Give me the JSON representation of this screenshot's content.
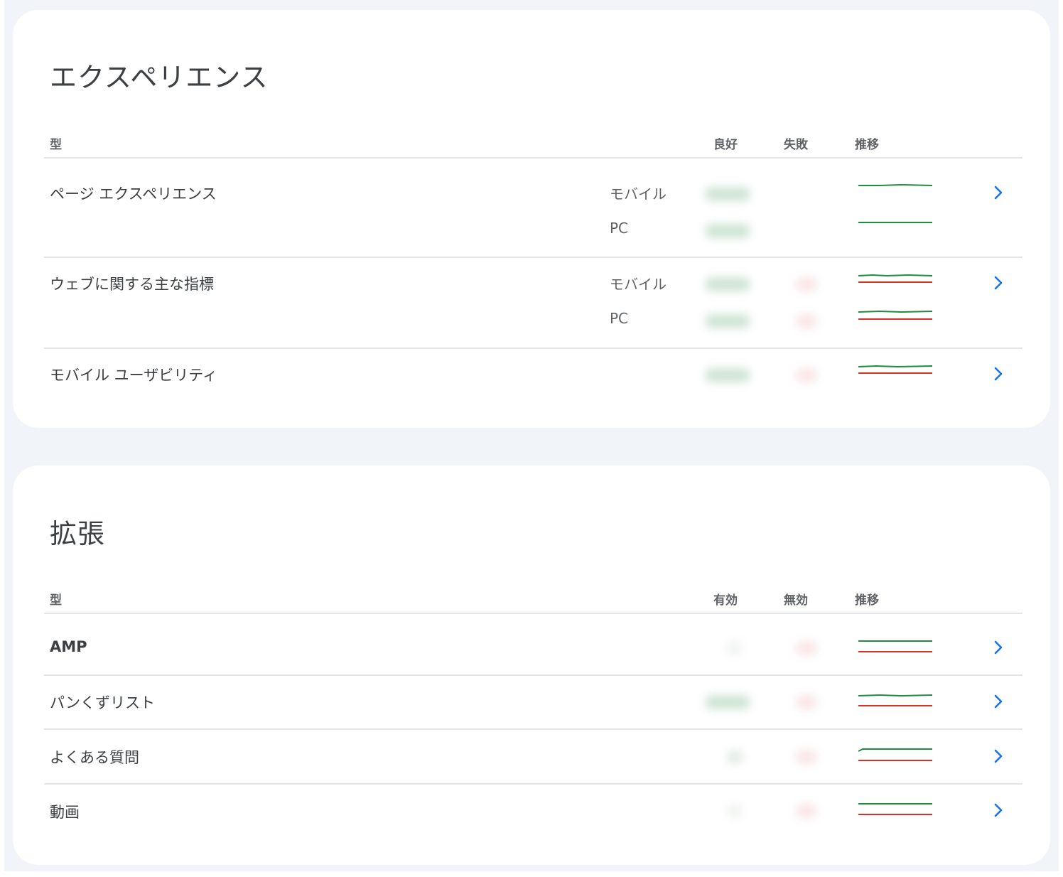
{
  "colors": {
    "background": "#f1f4f9",
    "card": "#ffffff",
    "trend_good": "#1e8e3e",
    "trend_bad": "#d93025",
    "chevron": "#1a73e8"
  },
  "experience": {
    "title": "エクスペリエンス",
    "columns": {
      "type": "型",
      "good": "良好",
      "failed": "失敗",
      "trend": "推移"
    },
    "rows": [
      {
        "name": "ページ エクスペリエンス",
        "devices": [
          {
            "label": "モバイル",
            "trend_lines": [
              "good"
            ]
          },
          {
            "label": "PC",
            "trend_lines": [
              "good"
            ]
          }
        ]
      },
      {
        "name": "ウェブに関する主な指標",
        "devices": [
          {
            "label": "モバイル",
            "trend_lines": [
              "good",
              "bad"
            ]
          },
          {
            "label": "PC",
            "trend_lines": [
              "good",
              "bad"
            ]
          }
        ]
      },
      {
        "name": "モバイル ユーザビリティ",
        "devices": [
          {
            "label": "",
            "trend_lines": [
              "good",
              "bad"
            ]
          }
        ]
      }
    ]
  },
  "enhancements": {
    "title": "拡張",
    "columns": {
      "type": "型",
      "valid": "有効",
      "invalid": "無効",
      "trend": "推移"
    },
    "rows": [
      {
        "name": "AMP",
        "trend_lines": [
          "good",
          "bad"
        ]
      },
      {
        "name": "パンくずリスト",
        "trend_lines": [
          "good",
          "bad"
        ]
      },
      {
        "name": "よくある質問",
        "trend_lines": [
          "good",
          "bad"
        ]
      },
      {
        "name": "動画",
        "trend_lines": [
          "good",
          "bad"
        ]
      }
    ]
  },
  "icons": {
    "row_open": "chevron-right-icon"
  }
}
